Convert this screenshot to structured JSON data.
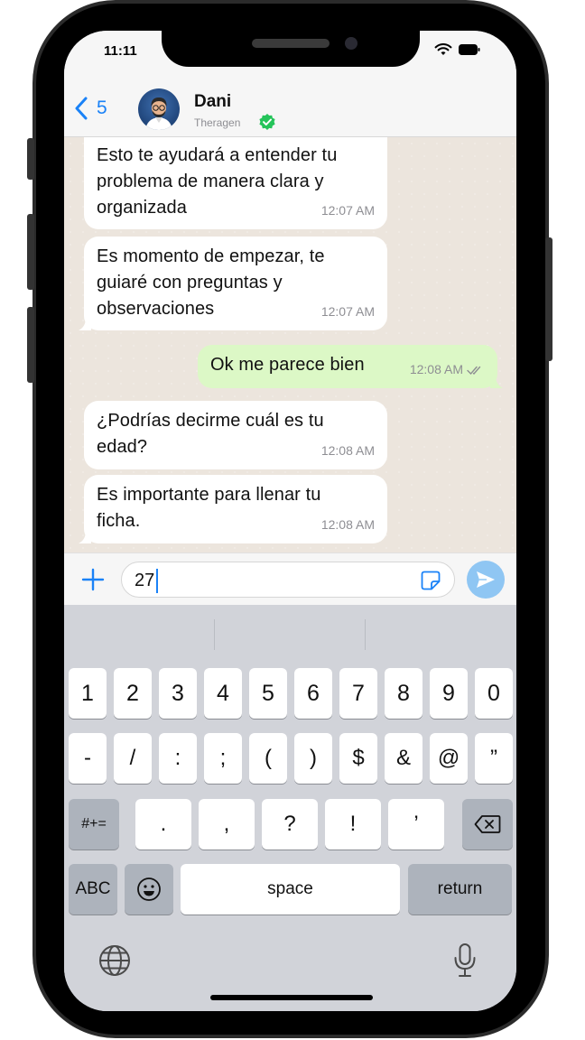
{
  "status_bar": {
    "time": "11:11"
  },
  "header": {
    "back_count": "5",
    "contact_name": "Dani",
    "contact_subtitle": "Theragen",
    "verified_color": "#25c45a"
  },
  "messages": [
    {
      "direction": "in",
      "text": "Esto te ayudará a entender tu\nproblema de manera clara y\norganizada",
      "time": "12:07 AM"
    },
    {
      "direction": "in",
      "text": "Es momento de empezar, te\nguiaré con preguntas y\nobservaciones",
      "time": "12:07 AM"
    },
    {
      "direction": "out",
      "text": "Ok me parece bien",
      "time": "12:08 AM"
    },
    {
      "direction": "in",
      "text": "¿Podrías decirme cuál es tu\nedad?",
      "time": "12:08 AM"
    },
    {
      "direction": "in",
      "text": "Es importante para llenar tu\nficha.",
      "time": "12:08 AM"
    }
  ],
  "composer": {
    "typed_text": "27"
  },
  "keyboard": {
    "row1": [
      "1",
      "2",
      "3",
      "4",
      "5",
      "6",
      "7",
      "8",
      "9",
      "0"
    ],
    "row2": [
      "-",
      "/",
      ":",
      ";",
      "(",
      ")",
      "$",
      "&",
      "@",
      "”"
    ],
    "row3_left": "#+=",
    "row3": [
      ".",
      ",",
      "?",
      "!",
      "’"
    ],
    "row4_left": "ABC",
    "space": "space",
    "return": "return"
  },
  "colors": {
    "accent": "#1a82f7",
    "outgoing_bubble": "#dcf8c6",
    "chat_bg": "#ece5dd"
  }
}
